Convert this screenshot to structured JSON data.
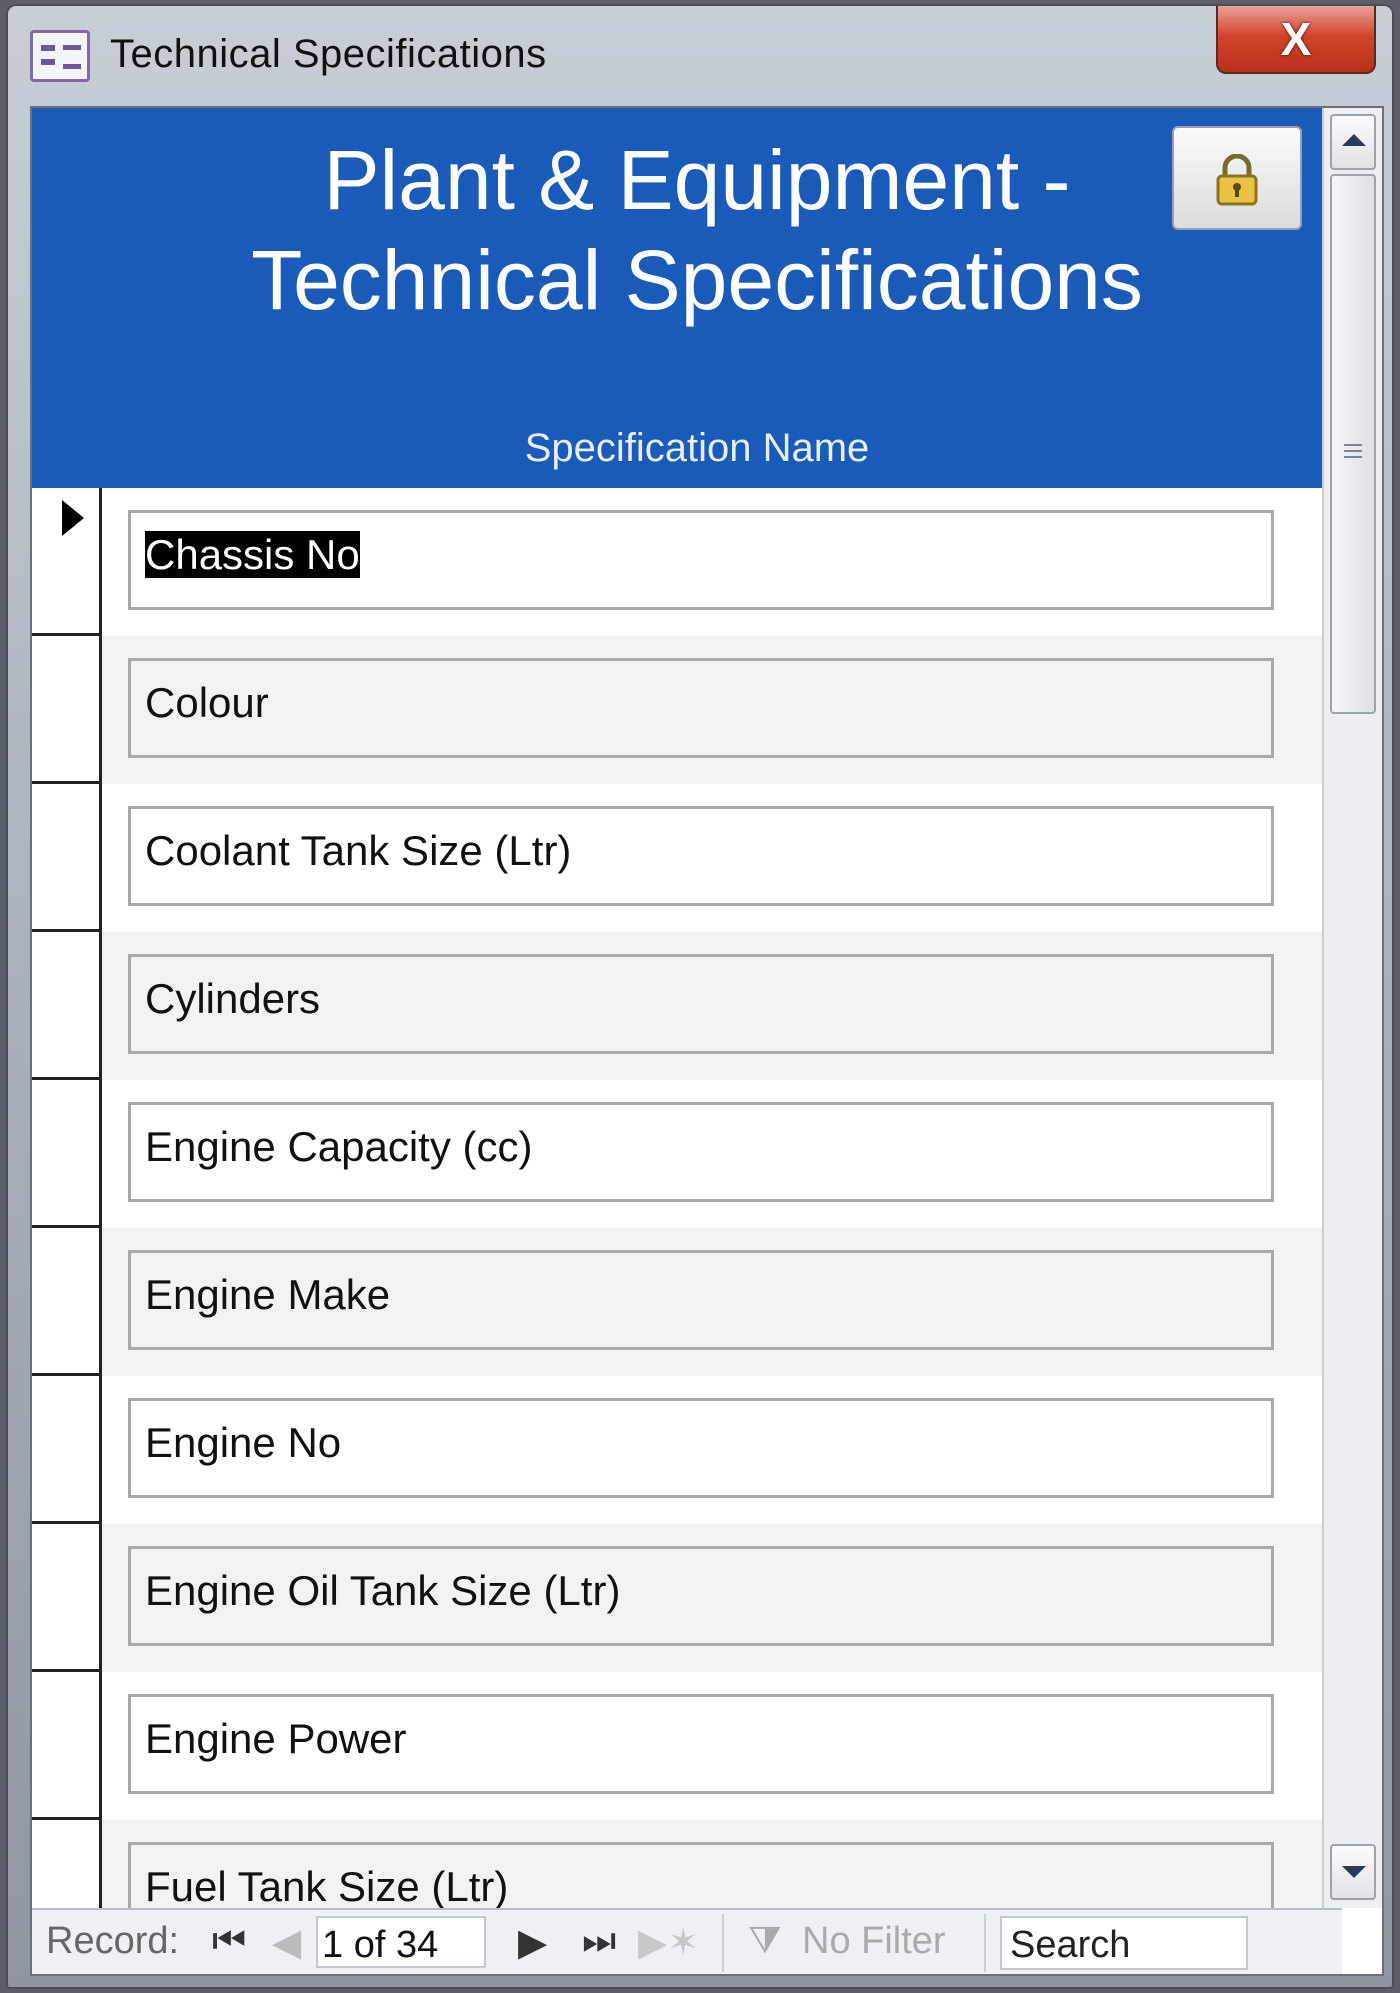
{
  "window": {
    "title": "Technical Specifications",
    "close_label": "X"
  },
  "header": {
    "title": "Plant & Equipment -\nTechnical Specifications",
    "column_header": "Specification Name",
    "color": "#1a5ab8"
  },
  "records": [
    {
      "name": "Chassis No",
      "selected": true
    },
    {
      "name": "Colour"
    },
    {
      "name": "Coolant Tank Size (Ltr)"
    },
    {
      "name": "Cylinders"
    },
    {
      "name": "Engine Capacity (cc)"
    },
    {
      "name": "Engine Make"
    },
    {
      "name": "Engine No"
    },
    {
      "name": "Engine Oil Tank Size (Ltr)"
    },
    {
      "name": "Engine Power"
    },
    {
      "name": "Fuel Tank Size (Ltr)"
    }
  ],
  "navigation": {
    "label": "Record:",
    "current": "1 of 34",
    "filter_label": "No Filter",
    "search_label": "Search"
  },
  "icons": {
    "first": "first-record-icon",
    "prev": "previous-record-icon",
    "next": "next-record-icon",
    "last": "last-record-icon",
    "new": "new-record-icon",
    "filter": "filter-icon",
    "lock": "lock-icon"
  }
}
